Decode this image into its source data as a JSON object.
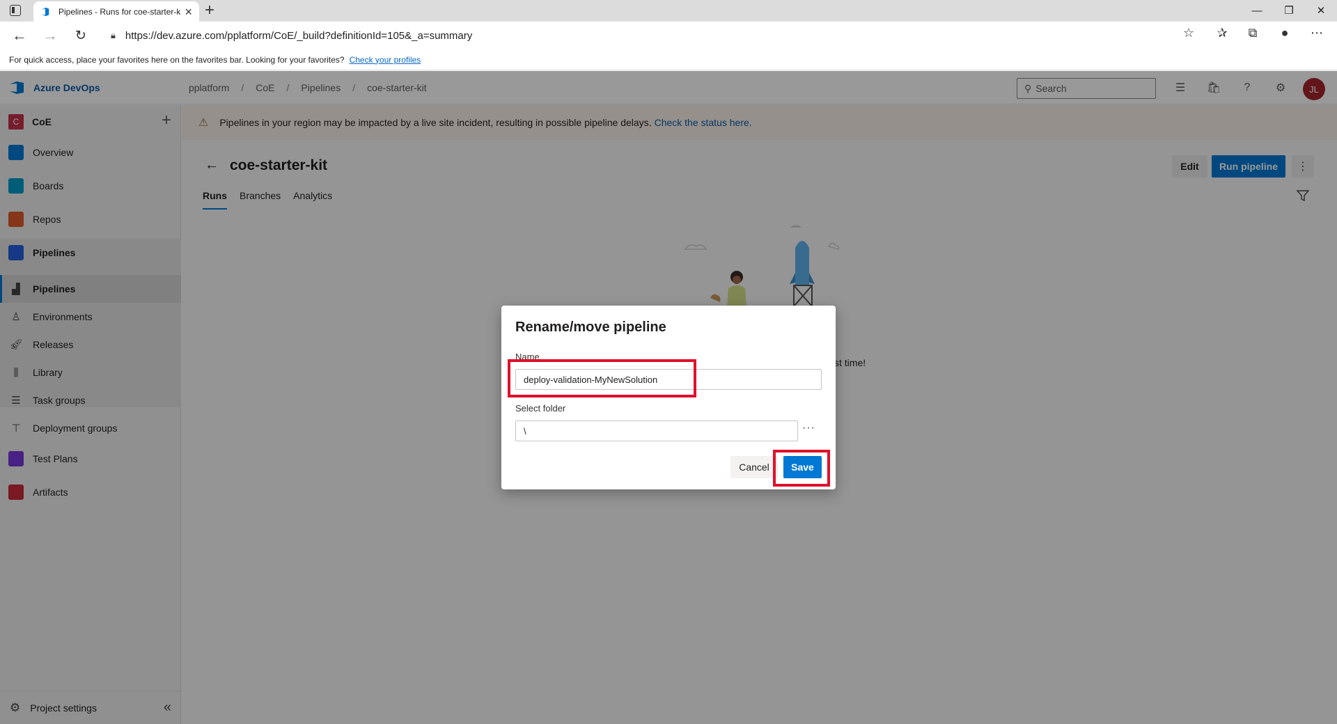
{
  "browser": {
    "tab_title": "Pipelines - Runs for coe-starter-k",
    "url": "https://dev.azure.com/pplatform/CoE/_build?definitionId=105&_a=summary",
    "favorites_text": "For quick access, place your favorites here on the favorites bar. Looking for your favorites?",
    "favorites_link": "Check your profiles"
  },
  "header": {
    "brand": "Azure DevOps",
    "breadcrumb": [
      "pplatform",
      "CoE",
      "Pipelines",
      "coe-starter-kit"
    ],
    "search_placeholder": "Search",
    "avatar_initials": "JL"
  },
  "sidebar": {
    "project_initial": "C",
    "project_name": "CoE",
    "items": [
      {
        "label": "Overview",
        "icon": "overview-icon",
        "color": "#0078d4"
      },
      {
        "label": "Boards",
        "icon": "boards-icon",
        "color": "#009ccc"
      },
      {
        "label": "Repos",
        "icon": "repos-icon",
        "color": "#e05a2b"
      },
      {
        "label": "Pipelines",
        "icon": "pipelines-icon",
        "color": "#2560e0"
      }
    ],
    "sub_items": [
      {
        "label": "Pipelines",
        "icon": "pipelines-sub-icon"
      },
      {
        "label": "Environments",
        "icon": "environments-icon"
      },
      {
        "label": "Releases",
        "icon": "releases-icon"
      },
      {
        "label": "Library",
        "icon": "library-icon"
      },
      {
        "label": "Task groups",
        "icon": "task-groups-icon"
      },
      {
        "label": "Deployment groups",
        "icon": "deployment-groups-icon"
      }
    ],
    "lower_items": [
      {
        "label": "Test Plans",
        "icon": "test-plans-icon",
        "color": "#773adc"
      },
      {
        "label": "Artifacts",
        "icon": "artifacts-icon",
        "color": "#cc293d"
      }
    ],
    "footer_label": "Project settings"
  },
  "banner": {
    "text": "Pipelines in your region may be impacted by a live site incident, resulting in possible pipeline delays.",
    "link": "Check the status here."
  },
  "page": {
    "title": "coe-starter-kit",
    "edit_label": "Edit",
    "run_label": "Run pipeline",
    "tabs": [
      "Runs",
      "Branches",
      "Analytics"
    ],
    "behind_text": "st time!"
  },
  "dialog": {
    "title": "Rename/move pipeline",
    "name_label": "Name",
    "name_value": "deploy-validation-MyNewSolution",
    "folder_label": "Select folder",
    "folder_value": "\\",
    "cancel_label": "Cancel",
    "save_label": "Save"
  }
}
